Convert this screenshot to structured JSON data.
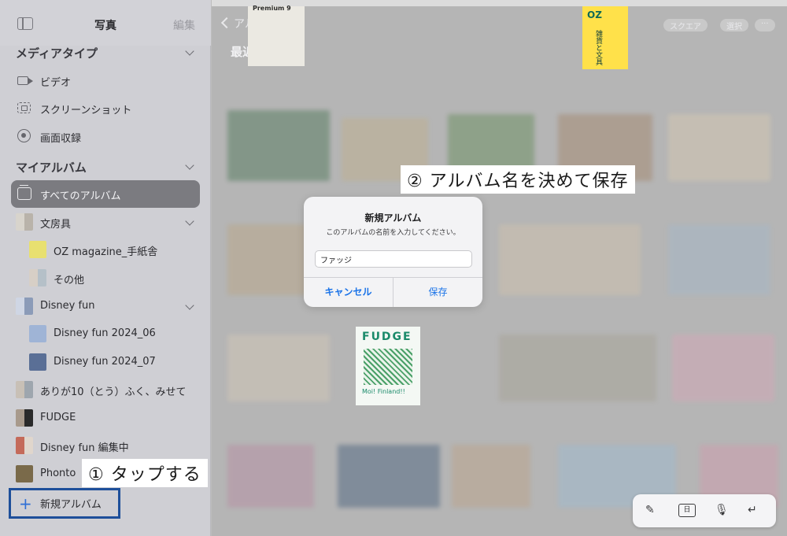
{
  "sidebar": {
    "title": "写真",
    "edit_label": "編集",
    "sections": {
      "media_types": "メディアタイプ",
      "my_albums": "マイアルバム"
    },
    "media_items": [
      {
        "label": "ビデオ"
      },
      {
        "label": "スクリーンショット"
      },
      {
        "label": "画面収録"
      }
    ],
    "album_items": [
      {
        "label": "すべてのアルバム",
        "selected": true
      },
      {
        "label": "文房具"
      },
      {
        "label": "OZ magazine_手紙舎"
      },
      {
        "label": "その他"
      },
      {
        "label": "Disney fun"
      },
      {
        "label": "Disney fun 2024_06"
      },
      {
        "label": "Disney fun 2024_07"
      },
      {
        "label": "ありが10（とう）ふく、みせて"
      },
      {
        "label": "FUDGE"
      },
      {
        "label": "Disney fun 編集中"
      },
      {
        "label": "Phonto"
      }
    ],
    "new_album_label": "新規アルバム"
  },
  "main": {
    "back_label": "アルバム",
    "section_title": "最近の項目",
    "top_pills": [
      "スクエア",
      "選択",
      "···"
    ]
  },
  "dialog": {
    "title": "新規アルバム",
    "message": "このアルバムの名前を入力してください。",
    "input_value": "ファッジ",
    "cancel_label": "キャンセル",
    "save_label": "保存"
  },
  "annotations": {
    "step1": "① タップする",
    "step2": "② アルバム名を決めて保存"
  },
  "thumb_text": {
    "fudge_title": "FUDGE",
    "fudge_sub": "Moi! Finland!!",
    "oz_title": "OZ",
    "oz_sub": "雑貨と文具",
    "premium_title": "Premium 9"
  },
  "keyboard_bar": {
    "date_label": "日"
  },
  "colors": {
    "accent": "#1a73e8",
    "highlight_border": "#1e4f9a",
    "selected_bg": "#7b7b80",
    "fudge_green": "#1a8a6a",
    "oz_yellow": "#ffe14a"
  }
}
